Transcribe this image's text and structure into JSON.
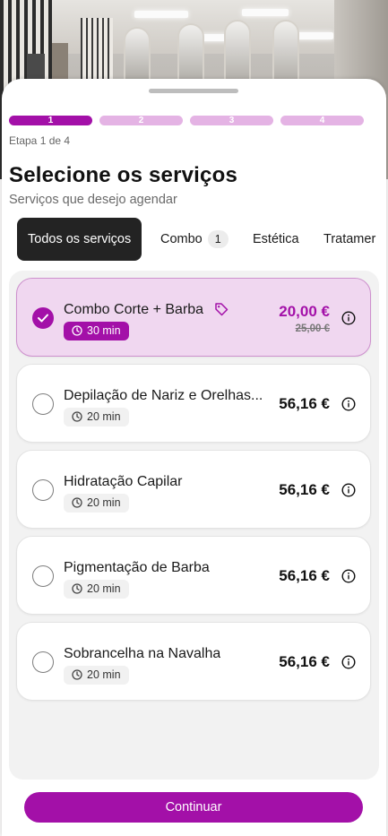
{
  "stepper": {
    "steps": [
      "1",
      "2",
      "3",
      "4"
    ],
    "active_index": 0,
    "caption": "Etapa 1 de 4"
  },
  "header": {
    "title": "Selecione os serviços",
    "subtitle": "Serviços que desejo agendar"
  },
  "tabs": [
    {
      "label": "Todos os serviços",
      "active": true
    },
    {
      "label": "Combo",
      "badge": "1"
    },
    {
      "label": "Estética"
    },
    {
      "label": "Tratamer"
    }
  ],
  "services": [
    {
      "name": "Combo Corte + Barba",
      "duration": "30 min",
      "price": "20,00 €",
      "old_price": "25,00 €",
      "selected": true,
      "promo_icon": "tag-icon"
    },
    {
      "name": "Depilação de Nariz e Orelhas...",
      "duration": "20 min",
      "price": "56,16 €",
      "selected": false
    },
    {
      "name": "Hidratação Capilar",
      "duration": "20 min",
      "price": "56,16 €",
      "selected": false
    },
    {
      "name": "Pigmentação de Barba",
      "duration": "20 min",
      "price": "56,16 €",
      "selected": false
    },
    {
      "name": "Sobrancelha na Navalha",
      "duration": "20 min",
      "price": "56,16 €",
      "selected": false
    }
  ],
  "footer": {
    "continue_label": "Continuar"
  },
  "colors": {
    "accent": "#a310a8",
    "accent_light": "#f0d7f0",
    "step_inactive": "#e4b3e4"
  }
}
